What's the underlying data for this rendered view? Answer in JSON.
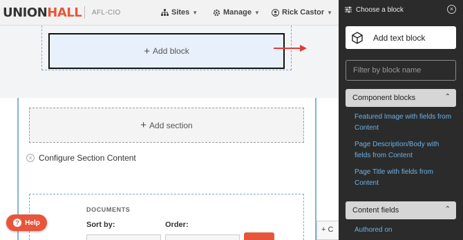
{
  "header": {
    "logo_part1": "UNION",
    "logo_part2": "HALL",
    "subbrand": "AFL-CIO",
    "nav": {
      "sites": "Sites",
      "manage": "Manage",
      "user": "Rick Castor"
    }
  },
  "layout_builder": {
    "add_block_label": "Add block",
    "add_section_label": "Add section",
    "configure_label": "Configure Section Content",
    "documents_title": "DOCUMENTS",
    "sort_by_label": "Sort by:",
    "order_label": "Order:",
    "peek_button_label": "+ C"
  },
  "help": {
    "label": "Help"
  },
  "panel": {
    "title": "Choose a block",
    "add_text_block": "Add text block",
    "filter_placeholder": "Filter by block name",
    "groups": [
      {
        "title": "Component blocks",
        "items": [
          "Featured Image with fields from Content",
          "Page Description/Body with fields from Content",
          "Page Title with fields from Content"
        ]
      },
      {
        "title": "Content fields",
        "items": [
          "Authored on"
        ]
      }
    ]
  },
  "colors": {
    "brand_orange": "#e8553a",
    "panel_bg": "#2b2b2b",
    "link_blue": "#6cb2e8",
    "annotation_arrow": "#e53935"
  }
}
